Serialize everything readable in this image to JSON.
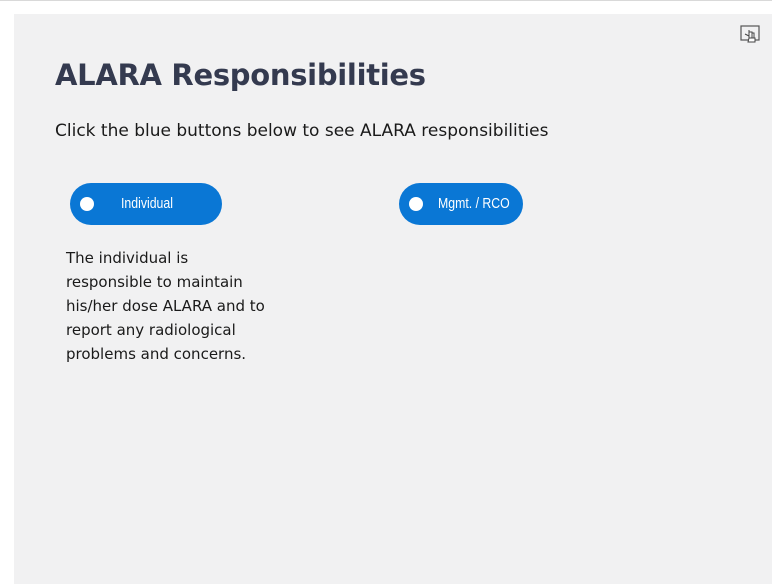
{
  "slide": {
    "title": "ALARA Responsibilities",
    "instructions": "Click the blue buttons below to see ALARA responsibilities"
  },
  "buttons": {
    "individual": "Individual",
    "mgmt": "Mgmt. / RCO"
  },
  "individual_text": {
    "lines": [
      "The individual is",
      "responsible to maintain",
      "his/her dose ALARA and to",
      "report any radiological",
      "problems and concerns."
    ]
  },
  "icons": {
    "corner": "touch-hand-icon"
  },
  "colors": {
    "button_blue": "#0a77d5",
    "title": "#343a4f",
    "slide_bg": "#f1f1f2"
  }
}
